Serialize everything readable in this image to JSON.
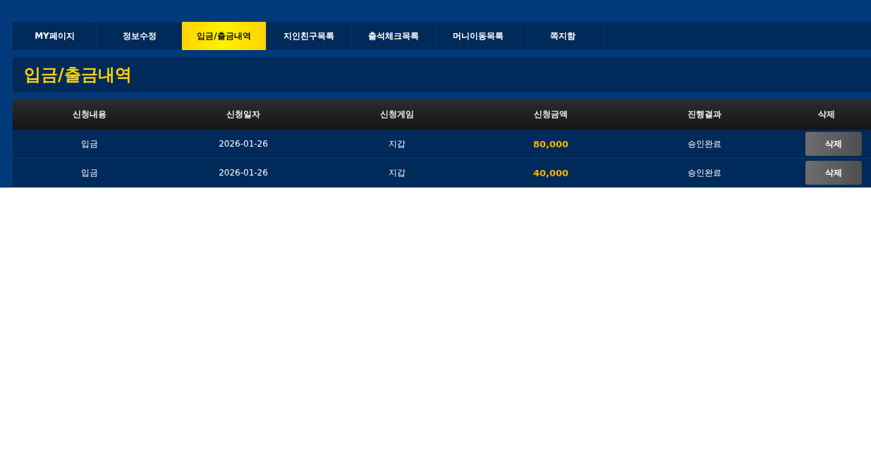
{
  "tabs": [
    {
      "label": "MY페이지",
      "selected": false
    },
    {
      "label": "정보수정",
      "selected": false
    },
    {
      "label": "입금/출금내역",
      "selected": true
    },
    {
      "label": "지인친구목록",
      "selected": false
    },
    {
      "label": "출석체크목록",
      "selected": false
    },
    {
      "label": "머니이동목록",
      "selected": false
    },
    {
      "label": "쪽지함",
      "selected": false
    }
  ],
  "page_title": "입금/출금내역",
  "table": {
    "columns": [
      "신청내용",
      "신청일자",
      "신청게임",
      "신청금액",
      "진행결과",
      "삭제"
    ],
    "rows": [
      {
        "type": "입금",
        "date": "2026-01-26",
        "game": "지갑",
        "amount": "80,000",
        "result": "승인완료",
        "action": "삭제"
      },
      {
        "type": "입금",
        "date": "2026-01-26",
        "game": "지갑",
        "amount": "40,000",
        "result": "승인완료",
        "action": "삭제"
      }
    ]
  }
}
